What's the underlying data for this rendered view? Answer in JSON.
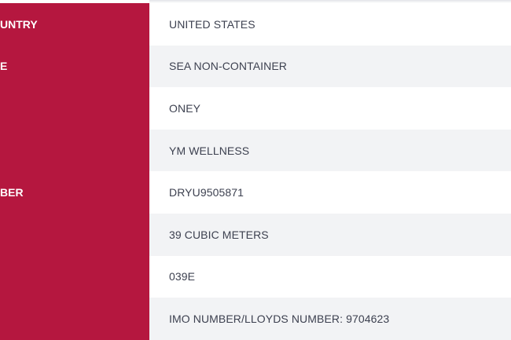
{
  "rows": [
    {
      "label": "UNTRY",
      "value": "UNITED STATES"
    },
    {
      "label": "E",
      "value": "SEA NON-CONTAINER"
    },
    {
      "label": "",
      "value": "ONEY"
    },
    {
      "label": "",
      "value": "YM WELLNESS"
    },
    {
      "label": "BER",
      "value": "DRYU9505871"
    },
    {
      "label": "",
      "value": "39 CUBIC METERS"
    },
    {
      "label": "",
      "value": "039E"
    },
    {
      "label": "",
      "value": "IMO NUMBER/LLOYDS NUMBER: 9704623"
    }
  ],
  "colors": {
    "label_background": "#b5173f",
    "label_text": "#ffffff",
    "value_text": "#3d4150",
    "row_alt_background": "#f2f3f5"
  }
}
